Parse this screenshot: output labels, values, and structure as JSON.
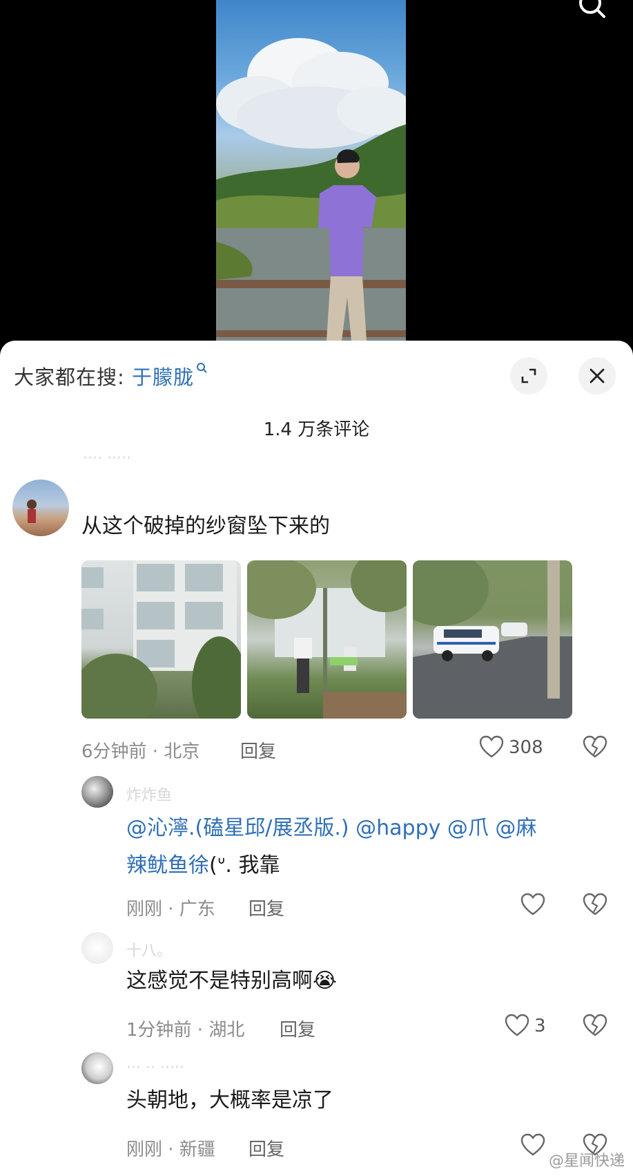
{
  "search_hint": {
    "prefix": "大家都在搜:",
    "keyword": "于朦胧"
  },
  "comment_count": "1.4 万条评论",
  "comments": [
    {
      "text": "从这个破掉的纱窗坠下来的",
      "time": "6分钟前 · 北京",
      "reply": "回复",
      "likes": "308"
    },
    {
      "username": "炸炸鱼",
      "mentions": "@沁濘.(磕星邱/展丞版.) @happy @爪 @麻",
      "text_line2_mention": "辣鱿鱼徐",
      "text_line2_rest": "(ᐡ. 我靠",
      "time": "刚刚 · 广东",
      "reply": "回复",
      "likes": ""
    },
    {
      "username": "十八。",
      "text": "这感觉不是特别高啊",
      "emoji": "😭",
      "time": "1分钟前 · 湖北",
      "reply": "回复",
      "likes": "3"
    },
    {
      "text": "头朝地，大概率是凉了",
      "time": "刚刚 · 新疆",
      "reply": "回复",
      "likes": ""
    }
  ],
  "watermark": "@星闻快递",
  "icons": [
    "search-icon",
    "expand-icon",
    "close-icon",
    "like-icon",
    "dislike-icon"
  ],
  "colors": {
    "mention": "#2f6fb7",
    "panel": "#ffffff",
    "background": "#000000"
  }
}
